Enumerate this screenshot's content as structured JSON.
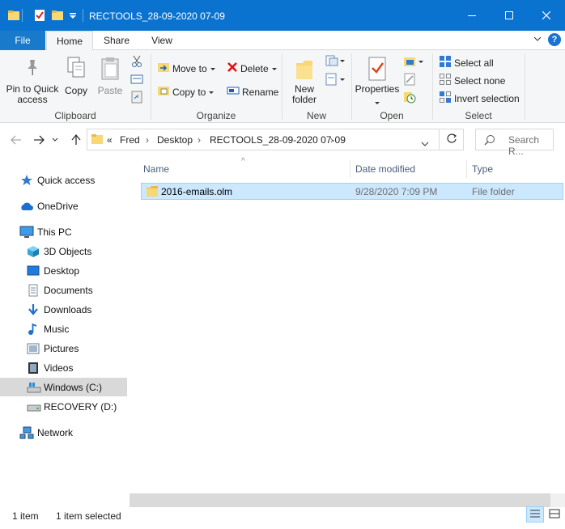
{
  "window": {
    "title": "RECTOOLS_28-09-2020 07-09",
    "controls": {
      "minimize": "—",
      "maximize": "☐",
      "close": "✕"
    }
  },
  "ribbon": {
    "tabs": [
      "File",
      "Home",
      "Share",
      "View"
    ],
    "help_glyph": "?",
    "expand_glyph": "⌄",
    "clipboard": {
      "group_label": "Clipboard",
      "pin_label": "Pin to Quick access",
      "copy_label": "Copy",
      "paste_label": "Paste"
    },
    "organize": {
      "group_label": "Organize",
      "move_to": "Move to",
      "copy_to": "Copy to",
      "delete": "Delete",
      "rename": "Rename"
    },
    "new": {
      "group_label": "New",
      "new_folder": "New folder"
    },
    "open": {
      "group_label": "Open",
      "properties": "Properties"
    },
    "select": {
      "group_label": "Select",
      "select_all": "Select all",
      "select_none": "Select none",
      "invert_selection": "Invert selection"
    }
  },
  "address": {
    "overflow": "«",
    "breadcrumbs": [
      "Fred",
      "Desktop",
      "RECTOOLS_28-09-2020 07-09"
    ],
    "separator": "›",
    "search_placeholder": "Search R..."
  },
  "nav_pane": {
    "items": [
      {
        "label": "Quick access",
        "icon": "star-icon"
      },
      {
        "label": "OneDrive",
        "icon": "cloud-icon"
      },
      {
        "label": "This PC",
        "icon": "computer-icon"
      },
      {
        "label": "3D Objects",
        "icon": "cube-icon"
      },
      {
        "label": "Desktop",
        "icon": "desktop-icon"
      },
      {
        "label": "Documents",
        "icon": "document-icon"
      },
      {
        "label": "Downloads",
        "icon": "download-icon"
      },
      {
        "label": "Music",
        "icon": "music-icon"
      },
      {
        "label": "Pictures",
        "icon": "picture-icon"
      },
      {
        "label": "Videos",
        "icon": "video-icon"
      },
      {
        "label": "Windows (C:)",
        "icon": "drive-icon",
        "selected": true
      },
      {
        "label": "RECOVERY (D:)",
        "icon": "drive-icon"
      },
      {
        "label": "Network",
        "icon": "network-icon"
      }
    ]
  },
  "file_list": {
    "columns": [
      "Name",
      "Date modified",
      "Type"
    ],
    "sort_glyph": "^",
    "rows": [
      {
        "name": "2016-emails.olm",
        "date_modified": "9/28/2020 7:09 PM",
        "type": "File folder",
        "selected": true
      }
    ]
  },
  "status_bar": {
    "item_count": "1 item",
    "selection": "1 item selected"
  },
  "colors": {
    "titlebar": "#0a72cf",
    "file_tab": "#1979ca",
    "selection_bg": "#cce8ff",
    "selection_border": "#99d1ff",
    "folder": "#f8d775"
  }
}
